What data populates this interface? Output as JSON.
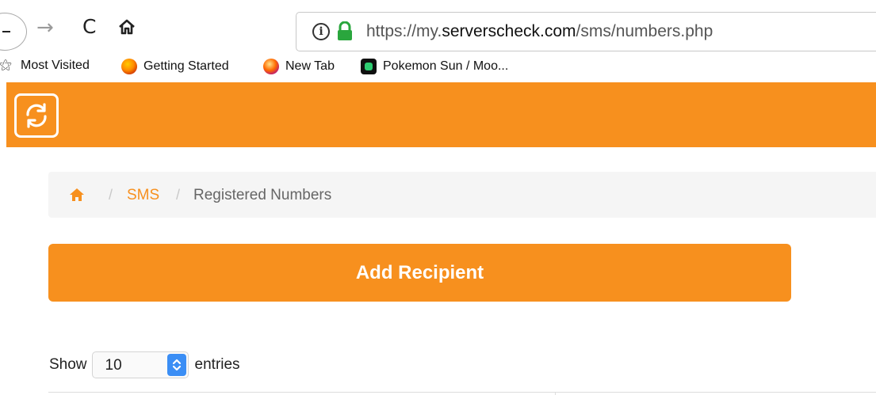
{
  "browser": {
    "url_prefix": "https://my.",
    "url_domain": "serverscheck.com",
    "url_path": "/sms/numbers.php",
    "icons": {
      "back": "back-arrow-icon",
      "forward": "forward-arrow-icon",
      "reload": "reload-icon",
      "home": "home-icon",
      "info": "info-icon",
      "lock": "lock-icon"
    },
    "info_glyph": "i"
  },
  "bookmarks": [
    {
      "label": "Most Visited",
      "icon": "star-icon"
    },
    {
      "label": "Getting Started",
      "icon": "firefox-icon"
    },
    {
      "label": "New Tab",
      "icon": "firefox-icon"
    },
    {
      "label": "Pokemon Sun / Moo...",
      "icon": "app-icon"
    }
  ],
  "app": {
    "logo_icon": "sync-icon",
    "header_color": "#f7901e"
  },
  "breadcrumb": {
    "home_icon": "home-icon",
    "separator": "/",
    "link": "SMS",
    "current": "Registered Numbers"
  },
  "actions": {
    "add_recipient": "Add Recipient"
  },
  "table_controls": {
    "show_label": "Show",
    "page_size": "10",
    "entries_label": "entries"
  },
  "colors": {
    "accent": "#f7901e",
    "select_arrow": "#3b8ef5",
    "lock": "#2aa63d"
  }
}
